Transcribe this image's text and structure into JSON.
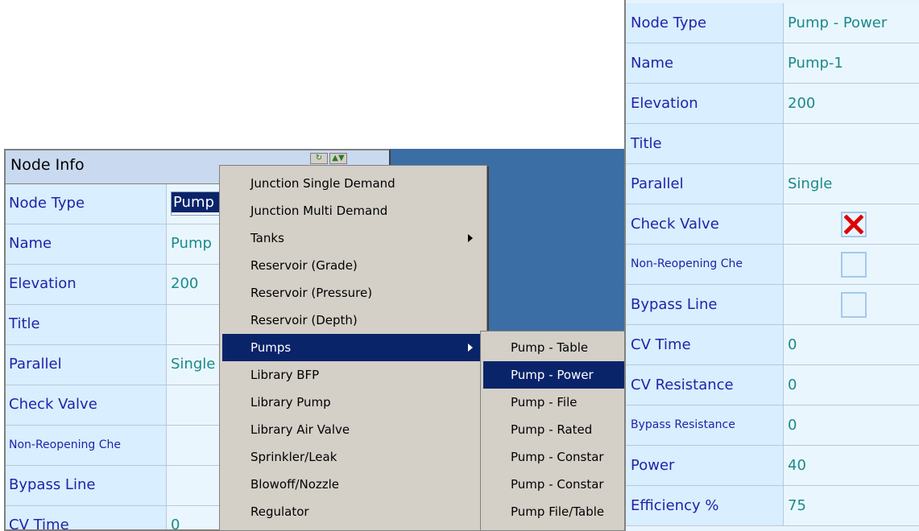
{
  "left_panel": {
    "title": "Node Info",
    "rows": [
      {
        "label": "Node Type",
        "value": "Pump"
      },
      {
        "label": "Name",
        "value": "Pump"
      },
      {
        "label": "Elevation",
        "value": "200"
      },
      {
        "label": "Title",
        "value": ""
      },
      {
        "label": "Parallel",
        "value": "Single"
      },
      {
        "label": "Check Valve",
        "value": ""
      },
      {
        "label": "Non-Reopening Che",
        "value": ""
      },
      {
        "label": "Bypass Line",
        "value": ""
      },
      {
        "label": "CV Time",
        "value": "0"
      }
    ]
  },
  "context_menu": {
    "items": [
      {
        "label": "Junction Single Demand"
      },
      {
        "label": "Junction Multi Demand"
      },
      {
        "label": "Tanks",
        "submenu": true
      },
      {
        "label": "Reservoir (Grade)"
      },
      {
        "label": "Reservoir (Pressure)"
      },
      {
        "label": "Reservoir (Depth)"
      },
      {
        "label": "Pumps",
        "submenu": true,
        "selected": true
      },
      {
        "label": "Library BFP"
      },
      {
        "label": "Library Pump"
      },
      {
        "label": "Library Air Valve"
      },
      {
        "label": "Sprinkler/Leak"
      },
      {
        "label": "Blowoff/Nozzle"
      },
      {
        "label": "Regulator"
      }
    ]
  },
  "sub_menu": {
    "items": [
      {
        "label": "Pump - Table"
      },
      {
        "label": "Pump - Power",
        "selected": true
      },
      {
        "label": "Pump - File"
      },
      {
        "label": "Pump - Rated"
      },
      {
        "label": "Pump - Constar"
      },
      {
        "label": "Pump - Constar"
      },
      {
        "label": "Pump File/Table"
      }
    ]
  },
  "right_panel": {
    "rows": [
      {
        "label": "Node Type",
        "value": "Pump - Power"
      },
      {
        "label": "Name",
        "value": "Pump-1"
      },
      {
        "label": "Elevation",
        "value": "200"
      },
      {
        "label": "Title",
        "value": ""
      },
      {
        "label": "Parallel",
        "value": "Single"
      },
      {
        "label": "Check Valve",
        "checkbox": true,
        "checked": true
      },
      {
        "label": "Non-Reopening Che",
        "checkbox": true,
        "checked": false
      },
      {
        "label": "Bypass Line",
        "checkbox": true,
        "checked": false
      },
      {
        "label": "CV Time",
        "value": "0"
      },
      {
        "label": "CV Resistance",
        "value": "0"
      },
      {
        "label": "Bypass Resistance",
        "value": "0"
      },
      {
        "label": "Power",
        "value": "40"
      },
      {
        "label": "Efficiency %",
        "value": "75"
      }
    ]
  },
  "colors": {
    "label_text": "#2222aa",
    "value_text": "#1a8a8a",
    "menu_highlight": "#0a246a",
    "backdrop": "#3a6ea5",
    "check_mark": "#e00000"
  }
}
